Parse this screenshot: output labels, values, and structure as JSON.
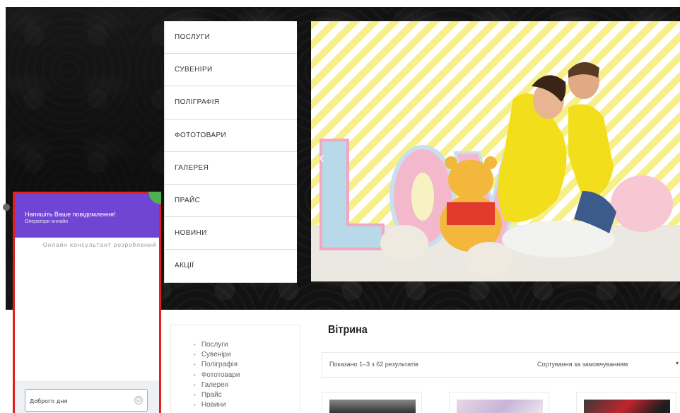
{
  "nav": {
    "items": [
      {
        "label": "ПОСЛУГИ"
      },
      {
        "label": "СУВЕНІРИ"
      },
      {
        "label": "ПОЛІГРАФІЯ"
      },
      {
        "label": "ФОТОТОВАРИ"
      },
      {
        "label": "ГАЛЕРЕЯ"
      },
      {
        "label": "ПРАЙС"
      },
      {
        "label": "НОВИНИ"
      },
      {
        "label": "АКЦІЇ"
      }
    ]
  },
  "chat": {
    "title": "Напишіть Ваше повідомлення!",
    "subtitle": "Оператори онлайн",
    "credit": "Онлайн консультант розроблений",
    "input_value": "Доброго дня",
    "emoji_icon": "smiley-icon",
    "accent": "#7145d4",
    "highlight_border": "#e1201d"
  },
  "sidebar": {
    "categories": [
      {
        "label": "Послуги"
      },
      {
        "label": "Сувеніри"
      },
      {
        "label": "Поліграфія"
      },
      {
        "label": "Фототовари"
      },
      {
        "label": "Галерея"
      },
      {
        "label": "Прайс"
      },
      {
        "label": "Новини"
      }
    ]
  },
  "shop": {
    "title": "Вітрина",
    "results": "Показано 1–3 з 62 результатів",
    "sort_selected": "Сортування за замовчуванням"
  }
}
